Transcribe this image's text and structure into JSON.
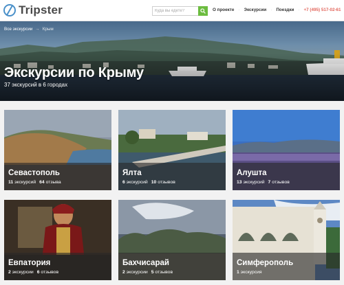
{
  "header": {
    "logo_text": "Tripster",
    "search_placeholder": "Куда вы едете?",
    "nav": [
      "О проекте",
      "Экскурсии",
      "Поездки"
    ],
    "phone": "+7 (495) 517-02-61"
  },
  "hero": {
    "breadcrumb_root": "Все экскурсии",
    "breadcrumb_arrow": "→",
    "breadcrumb_current": "Крым",
    "title": "Экскурсии по Крыму",
    "subtitle": "37 экскурсий в 6 городах"
  },
  "cities": [
    {
      "name": "Севастополь",
      "count": "11",
      "count_label": "экскурсий",
      "reviews": "64",
      "reviews_label": "отзыва"
    },
    {
      "name": "Ялта",
      "count": "6",
      "count_label": "экскурсий",
      "reviews": "10",
      "reviews_label": "отзывов"
    },
    {
      "name": "Алушта",
      "count": "13",
      "count_label": "экскурсий",
      "reviews": "7",
      "reviews_label": "отзывов"
    },
    {
      "name": "Евпатория",
      "count": "2",
      "count_label": "экскурсии",
      "reviews": "6",
      "reviews_label": "отзывов"
    },
    {
      "name": "Бахчисарай",
      "count": "2",
      "count_label": "экскурсии",
      "reviews": "5",
      "reviews_label": "отзывов"
    },
    {
      "name": "Симферополь",
      "count": "1",
      "count_label": "экскурсия",
      "reviews": "",
      "reviews_label": ""
    }
  ],
  "colors": {
    "accent_green": "#6cbc40",
    "phone_red": "#e2645a",
    "logo_blue": "#4a90c9"
  }
}
